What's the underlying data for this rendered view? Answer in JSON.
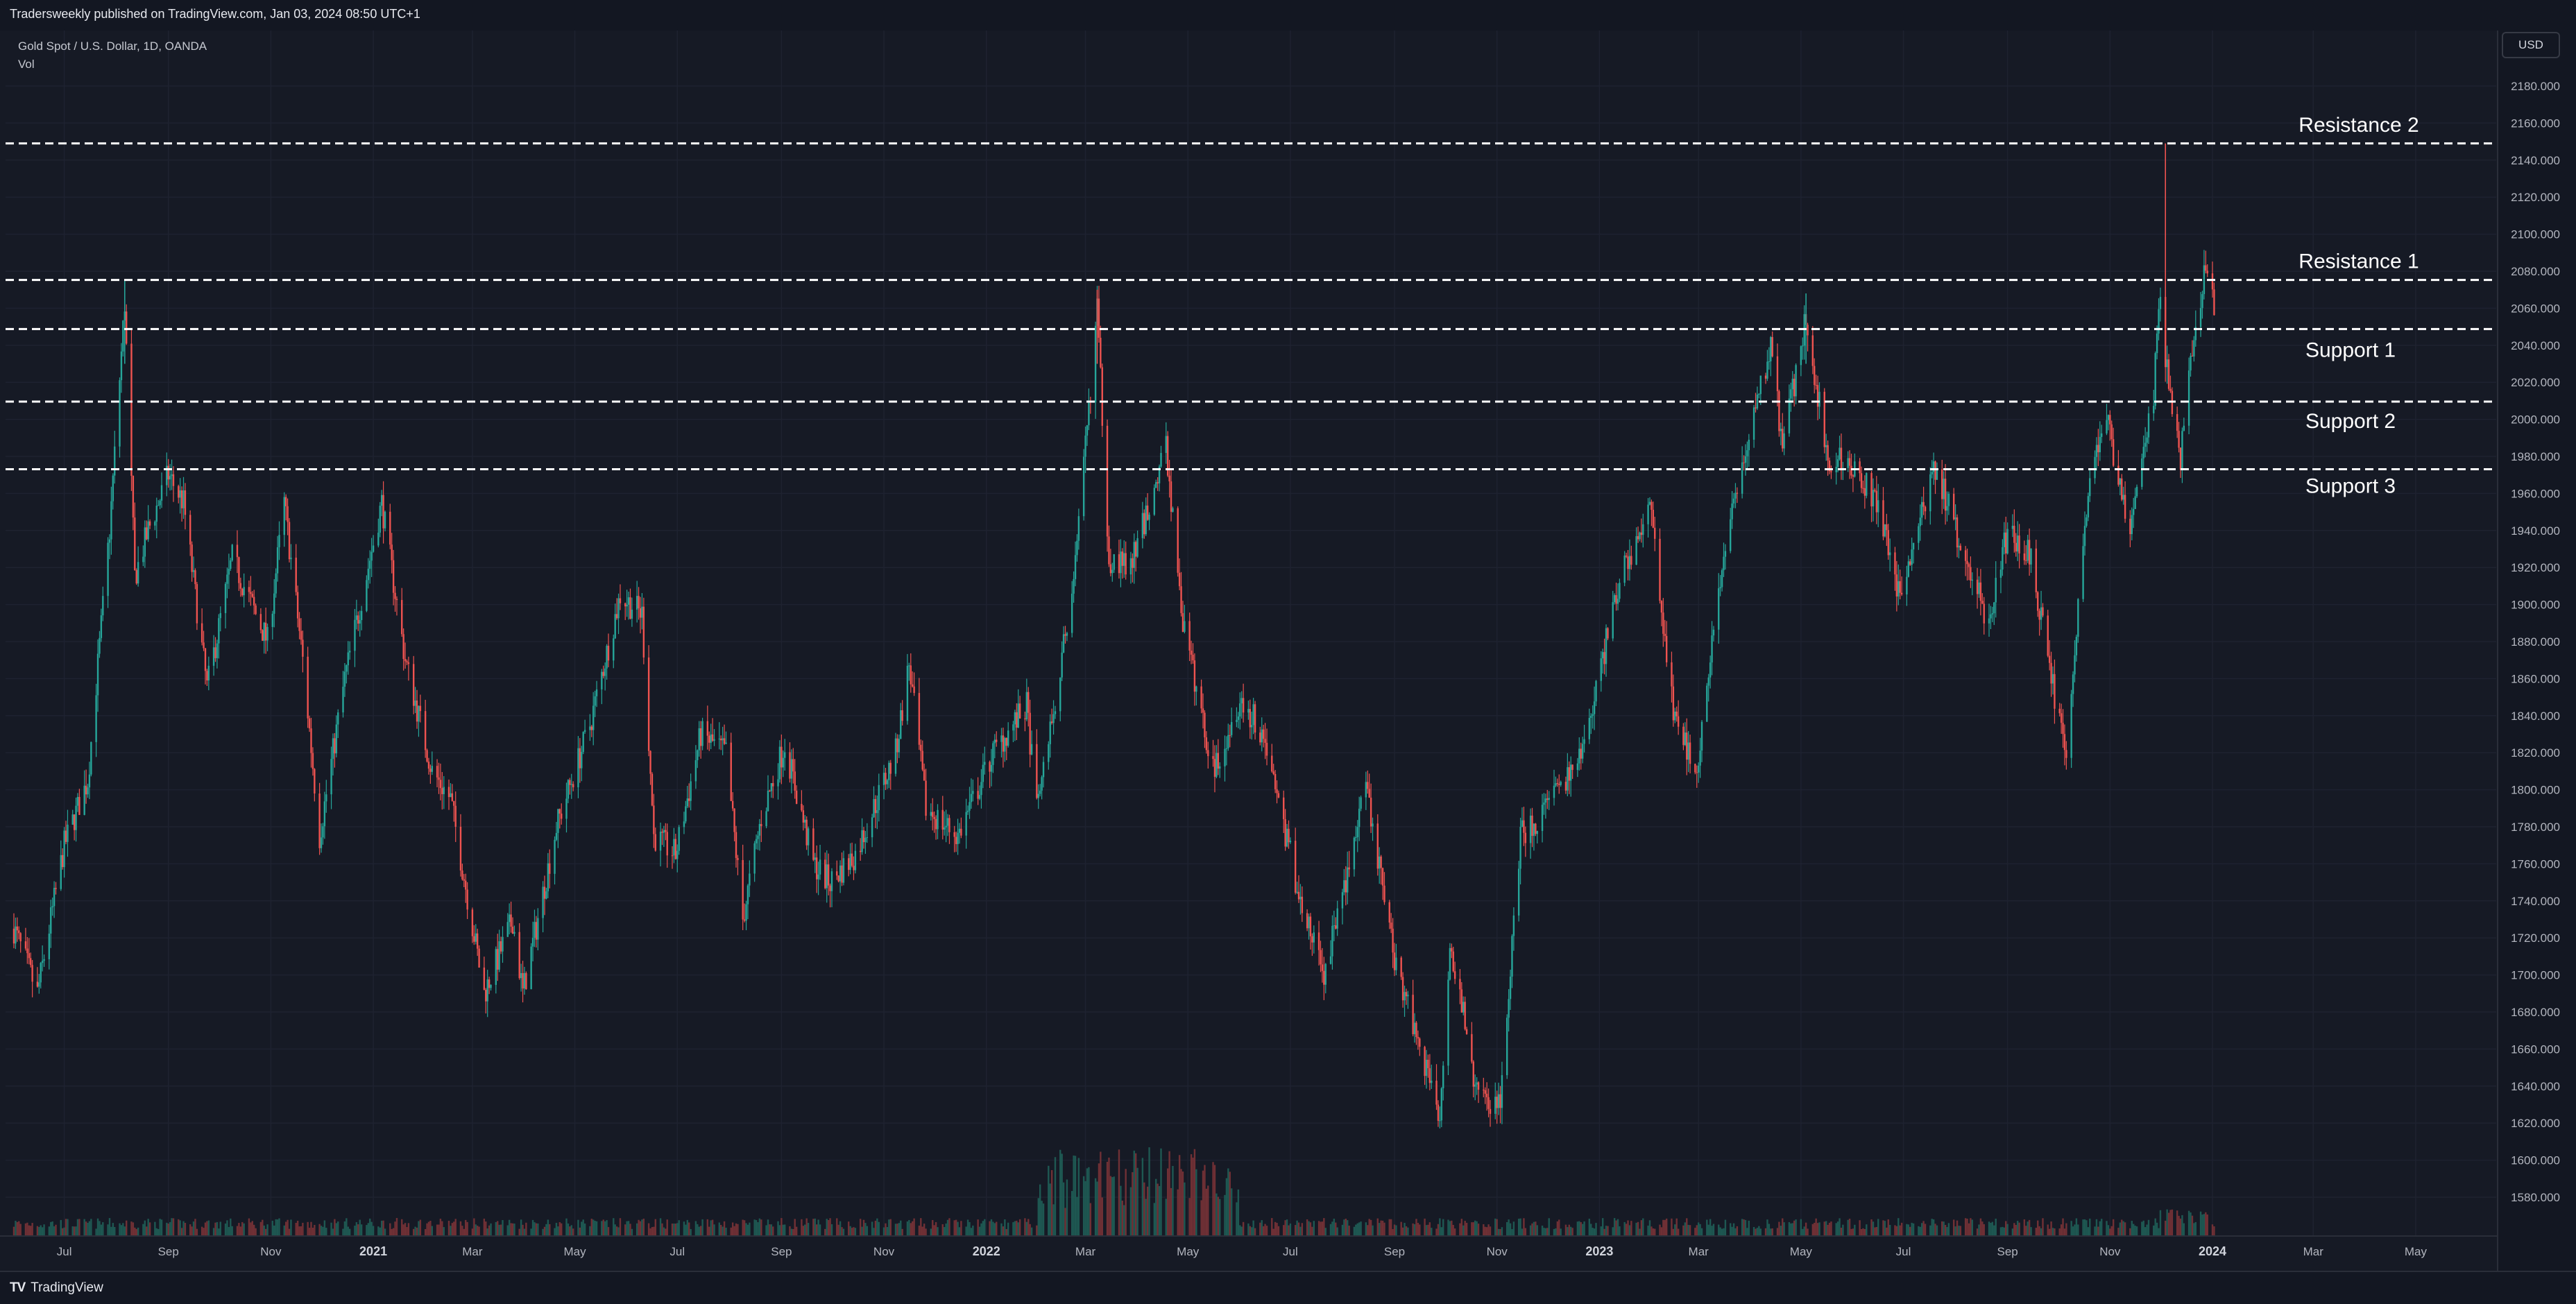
{
  "header": {
    "publish_text": "Tradersweekly published on TradingView.com, Jan 03, 2024 08:50 UTC+1"
  },
  "legend": {
    "symbol": "Gold Spot / U.S. Dollar, 1D, OANDA",
    "indicator": "Vol"
  },
  "price_scale": {
    "currency": "USD"
  },
  "footer": {
    "brand": "TradingView",
    "logo_text": "TV"
  },
  "colors": {
    "background": "#131722",
    "up": "#26a69a",
    "down": "#ef5350",
    "grid": "#1e2230",
    "text": "#d1d4dc",
    "level_line": "#ffffff"
  },
  "chart_data": {
    "type": "candlestick",
    "title": "Gold Spot / U.S. Dollar, 1D, OANDA",
    "ylim": [
      1565,
      2197
    ],
    "y_ticks": [
      "2180.000",
      "2160.000",
      "2140.000",
      "2120.000",
      "2100.000",
      "2080.000",
      "2060.000",
      "2040.000",
      "2020.000",
      "2000.000",
      "1980.000",
      "1960.000",
      "1940.000",
      "1920.000",
      "1900.000",
      "1880.000",
      "1860.000",
      "1840.000",
      "1820.000",
      "1800.000",
      "1780.000",
      "1760.000",
      "1740.000",
      "1720.000",
      "1700.000",
      "1680.000",
      "1660.000",
      "1640.000",
      "1620.000",
      "1600.000",
      "1580.000"
    ],
    "x_ticks": [
      "Jul",
      "Sep",
      "Nov",
      "2021",
      "Mar",
      "May",
      "Jul",
      "Sep",
      "Nov",
      "2022",
      "Mar",
      "May",
      "Jul",
      "Sep",
      "Nov",
      "2023",
      "Mar",
      "May",
      "Jul",
      "Sep",
      "Nov",
      "2024",
      "Mar",
      "May"
    ],
    "levels": [
      {
        "name": "Resistance 2",
        "value": 2148.99,
        "tag": "2148.990"
      },
      {
        "name": "Resistance 1",
        "value": 2075.282,
        "tag": "2075.282"
      },
      {
        "name": "Support 1",
        "value": 2048.77,
        "tag": "2048.770"
      },
      {
        "name": "Support 2",
        "value": 2009.565,
        "tag": "2009.565"
      },
      {
        "name": "Support 3",
        "value": 1973.09,
        "tag": "1973.090"
      }
    ],
    "price_path": [
      [
        "2020-06-01",
        1725
      ],
      [
        "2020-06-15",
        1690
      ],
      [
        "2020-07-01",
        1770
      ],
      [
        "2020-07-15",
        1805
      ],
      [
        "2020-07-28",
        1940
      ],
      [
        "2020-08-06",
        2063
      ],
      [
        "2020-08-12",
        1915
      ],
      [
        "2020-08-20",
        1940
      ],
      [
        "2020-09-01",
        1970
      ],
      [
        "2020-09-10",
        1955
      ],
      [
        "2020-09-24",
        1855
      ],
      [
        "2020-10-09",
        1925
      ],
      [
        "2020-10-30",
        1880
      ],
      [
        "2020-11-09",
        1955
      ],
      [
        "2020-11-20",
        1870
      ],
      [
        "2020-11-30",
        1775
      ],
      [
        "2020-12-15",
        1860
      ],
      [
        "2021-01-06",
        1955
      ],
      [
        "2021-01-20",
        1870
      ],
      [
        "2021-02-05",
        1810
      ],
      [
        "2021-02-16",
        1795
      ],
      [
        "2021-03-08",
        1690
      ],
      [
        "2021-03-25",
        1730
      ],
      [
        "2021-03-31",
        1690
      ],
      [
        "2021-04-20",
        1780
      ],
      [
        "2021-05-10",
        1835
      ],
      [
        "2021-05-28",
        1905
      ],
      [
        "2021-06-10",
        1895
      ],
      [
        "2021-06-17",
        1775
      ],
      [
        "2021-06-30",
        1765
      ],
      [
        "2021-07-15",
        1830
      ],
      [
        "2021-07-30",
        1820
      ],
      [
        "2021-08-09",
        1730
      ],
      [
        "2021-08-20",
        1785
      ],
      [
        "2021-09-03",
        1825
      ],
      [
        "2021-09-20",
        1760
      ],
      [
        "2021-09-30",
        1750
      ],
      [
        "2021-10-15",
        1765
      ],
      [
        "2021-11-08",
        1820
      ],
      [
        "2021-11-16",
        1868
      ],
      [
        "2021-11-26",
        1790
      ],
      [
        "2021-12-15",
        1775
      ],
      [
        "2022-01-05",
        1820
      ],
      [
        "2022-01-25",
        1845
      ],
      [
        "2022-01-31",
        1790
      ],
      [
        "2022-02-15",
        1870
      ],
      [
        "2022-02-24",
        1930
      ],
      [
        "2022-03-08",
        2060
      ],
      [
        "2022-03-15",
        1925
      ],
      [
        "2022-03-28",
        1920
      ],
      [
        "2022-04-18",
        1985
      ],
      [
        "2022-04-28",
        1890
      ],
      [
        "2022-05-16",
        1810
      ],
      [
        "2022-06-01",
        1850
      ],
      [
        "2022-06-15",
        1830
      ],
      [
        "2022-07-07",
        1740
      ],
      [
        "2022-07-21",
        1700
      ],
      [
        "2022-08-15",
        1800
      ],
      [
        "2022-09-01",
        1710
      ],
      [
        "2022-09-28",
        1625
      ],
      [
        "2022-10-04",
        1720
      ],
      [
        "2022-10-20",
        1635
      ],
      [
        "2022-11-03",
        1630
      ],
      [
        "2022-11-15",
        1775
      ],
      [
        "2022-12-01",
        1790
      ],
      [
        "2022-12-20",
        1815
      ],
      [
        "2023-01-15",
        1920
      ],
      [
        "2023-02-01",
        1950
      ],
      [
        "2023-02-14",
        1840
      ],
      [
        "2023-02-28",
        1812
      ],
      [
        "2023-03-15",
        1920
      ],
      [
        "2023-03-28",
        1980
      ],
      [
        "2023-04-13",
        2040
      ],
      [
        "2023-04-20",
        1985
      ],
      [
        "2023-05-04",
        2055
      ],
      [
        "2023-05-17",
        1980
      ],
      [
        "2023-06-01",
        1975
      ],
      [
        "2023-06-15",
        1955
      ],
      [
        "2023-06-29",
        1905
      ],
      [
        "2023-07-20",
        1975
      ],
      [
        "2023-08-03",
        1935
      ],
      [
        "2023-08-21",
        1890
      ],
      [
        "2023-09-01",
        1940
      ],
      [
        "2023-09-15",
        1925
      ],
      [
        "2023-09-29",
        1850
      ],
      [
        "2023-10-06",
        1820
      ],
      [
        "2023-10-20",
        1975
      ],
      [
        "2023-10-31",
        1995
      ],
      [
        "2023-11-13",
        1940
      ],
      [
        "2023-11-27",
        2015
      ],
      [
        "2023-12-01",
        2072
      ],
      [
        "2023-12-04",
        2035
      ],
      [
        "2023-12-13",
        1980
      ],
      [
        "2023-12-20",
        2035
      ],
      [
        "2023-12-28",
        2083
      ],
      [
        "2024-01-02",
        2064
      ]
    ]
  }
}
